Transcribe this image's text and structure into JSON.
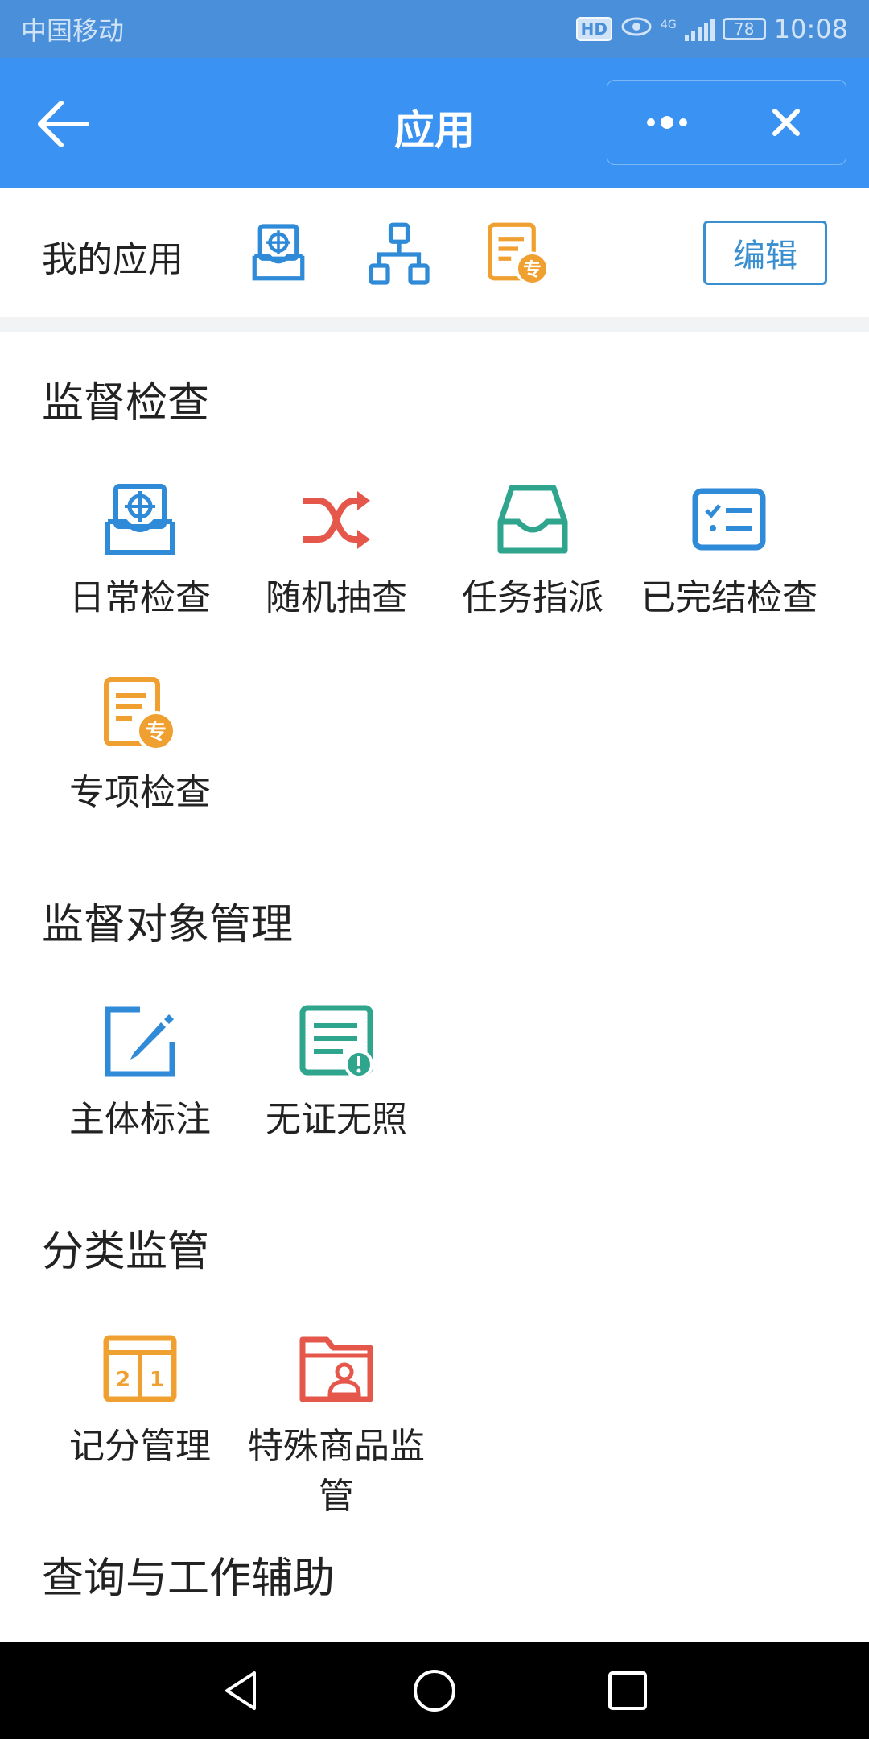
{
  "status_bar": {
    "carrier": "中国移动",
    "hd": "HD",
    "network": "4G",
    "battery": "78",
    "time": "10:08"
  },
  "header": {
    "title": "应用"
  },
  "my_apps": {
    "label": "我的应用",
    "edit_label": "编辑"
  },
  "sections": [
    {
      "title": "监督检查",
      "items": [
        {
          "label": "日常检查",
          "icon": "target-inbox-icon"
        },
        {
          "label": "随机抽查",
          "icon": "shuffle-icon"
        },
        {
          "label": "任务指派",
          "icon": "inbox-tray-icon"
        },
        {
          "label": "已完结检查",
          "icon": "checklist-icon"
        },
        {
          "label": "专项检查",
          "icon": "special-doc-icon"
        }
      ]
    },
    {
      "title": "监督对象管理",
      "items": [
        {
          "label": "主体标注",
          "icon": "edit-pencil-icon"
        },
        {
          "label": "无证无照",
          "icon": "doc-alert-icon"
        }
      ]
    },
    {
      "title": "分类监管",
      "items": [
        {
          "label": "记分管理",
          "icon": "score-board-icon"
        },
        {
          "label": "特殊商品监管",
          "icon": "folder-user-icon"
        }
      ]
    },
    {
      "title": "查询与工作辅助",
      "items": []
    }
  ],
  "icon_glyphs": {
    "special": "专",
    "score_left": "2",
    "score_right": "1"
  },
  "colors": {
    "header_blue": "#3a93f2",
    "icon_blue": "#2f8ad8",
    "icon_red": "#e5574a",
    "icon_teal": "#2fa58e",
    "icon_orange": "#f0a030"
  }
}
